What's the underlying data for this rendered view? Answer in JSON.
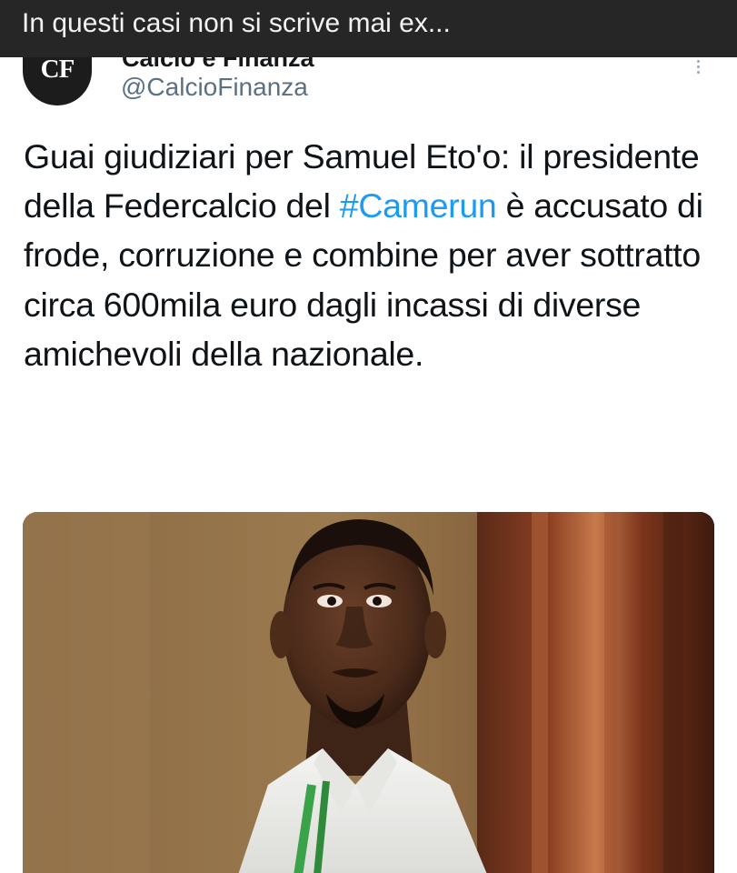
{
  "caption": {
    "text": "In questi casi non si scrive mai ex..."
  },
  "account": {
    "name_clipped": "Calcio e Finanza",
    "handle": "@CalcioFinanza",
    "avatar_text": "CF",
    "verified_icon": "verified-badge-icon"
  },
  "tweet": {
    "text_before_hashtag": "Guai giudiziari per Samuel Eto'o: il presidente della Federcalcio del ",
    "hashtag": "#Camerun",
    "text_after_hashtag": " è accusato di frode, corruzione e combine per aver sottratto circa 600mila euro dagli incassi di diverse amichevoli della nazionale."
  },
  "media": {
    "icon": "photo"
  },
  "colors": {
    "caption_bar": "#262626",
    "hashtag": "#1d9bf0",
    "handle": "#5b7083",
    "text": "#0f1419"
  }
}
